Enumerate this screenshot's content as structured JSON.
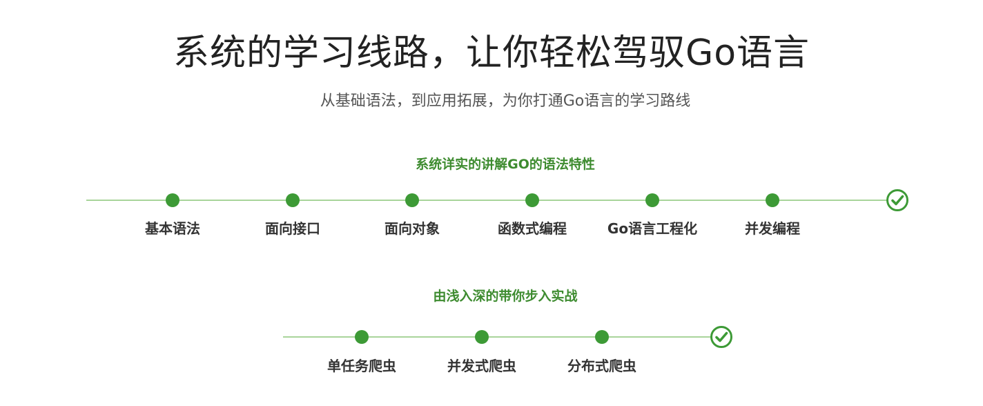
{
  "header": {
    "title": "系统的学习线路，让你轻松驾驭Go语言",
    "subtitle": "从基础语法，到应用拓展，为你打通Go语言的学习路线"
  },
  "colors": {
    "accent_green": "#3d9a36",
    "heading_green": "#3d8b2f",
    "line_green": "#a8d49a",
    "title_text": "#222222",
    "label_text": "#333333"
  },
  "sections": [
    {
      "heading": "系统详实的讲解GO的语法特性",
      "steps": [
        "基本语法",
        "面向接口",
        "面向对象",
        "函数式编程",
        "Go语言工程化",
        "并发编程"
      ],
      "end_icon": "check-circle-icon"
    },
    {
      "heading": "由浅入深的带你步入实战",
      "steps": [
        "单任务爬虫",
        "并发式爬虫",
        "分布式爬虫"
      ],
      "end_icon": "check-circle-icon"
    }
  ]
}
